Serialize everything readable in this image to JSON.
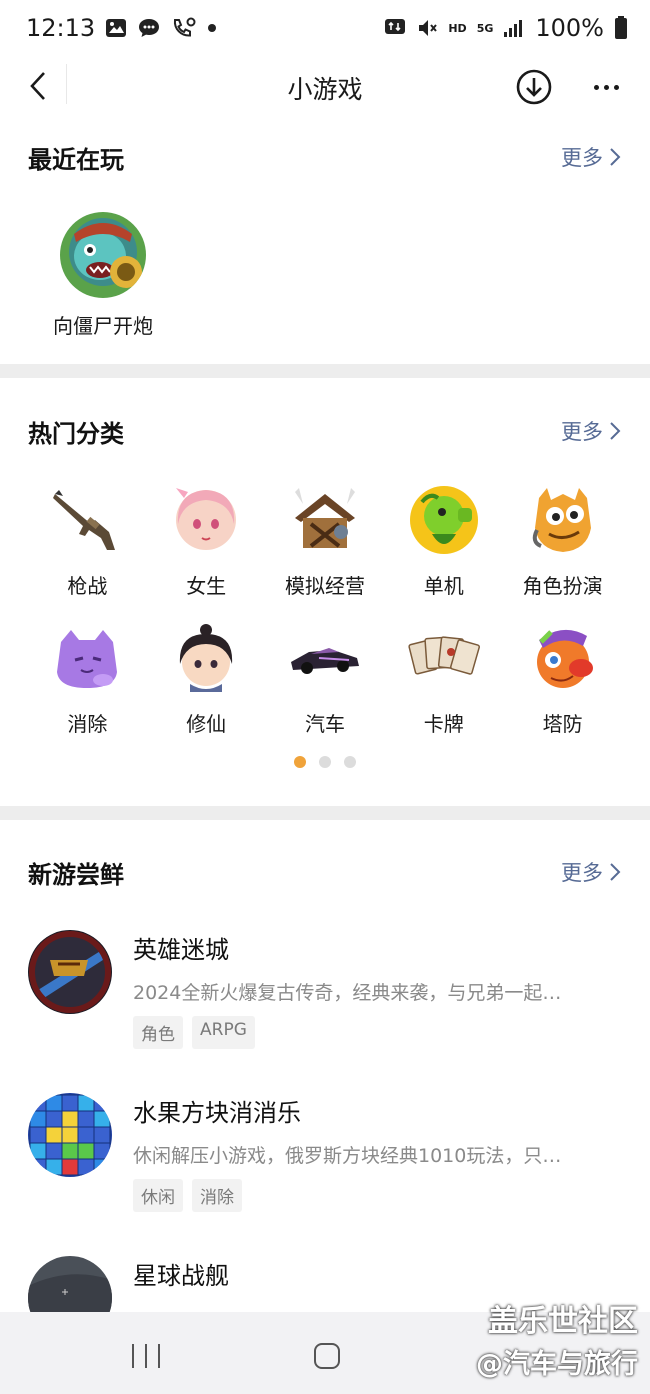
{
  "status_bar": {
    "time": "12:13",
    "battery": "100%",
    "hd": "HD",
    "net": "5G",
    "icons_left": [
      "image-icon",
      "chat-bubble-icon",
      "phone-location-icon",
      "dot-icon"
    ],
    "icons_right": [
      "sync-icon",
      "mute-icon",
      "signal-icon",
      "battery-icon"
    ]
  },
  "nav": {
    "title": "小游戏",
    "back_icon": "chevron-left-icon",
    "download_icon": "download-circle-icon",
    "more_icon": "more-dots-icon"
  },
  "recent": {
    "title": "最近在玩",
    "more": "更多",
    "items": [
      {
        "name": "向僵尸开炮",
        "icon": "zombie-game-icon"
      }
    ]
  },
  "categories": {
    "title": "热门分类",
    "more": "更多",
    "items": [
      {
        "label": "枪战",
        "icon": "rifle-icon"
      },
      {
        "label": "女生",
        "icon": "anime-girl-icon"
      },
      {
        "label": "模拟经营",
        "icon": "cabin-icon"
      },
      {
        "label": "单机",
        "icon": "peashooter-icon"
      },
      {
        "label": "角色扮演",
        "icon": "orange-monster-icon"
      },
      {
        "label": "消除",
        "icon": "purple-cat-icon"
      },
      {
        "label": "修仙",
        "icon": "cultivator-icon"
      },
      {
        "label": "汽车",
        "icon": "race-car-icon"
      },
      {
        "label": "卡牌",
        "icon": "playing-cards-icon"
      },
      {
        "label": "塔防",
        "icon": "tower-defense-bird-icon"
      }
    ],
    "pages": 3,
    "active_page": 1
  },
  "new_games": {
    "title": "新游尝鲜",
    "more": "更多",
    "items": [
      {
        "name": "英雄迷城",
        "desc": "2024全新火爆复古传奇，经典来袭，与兄弟一起…",
        "tags": [
          "角色",
          "ARPG"
        ],
        "icon": "hero-city-game-icon"
      },
      {
        "name": "水果方块消消乐",
        "desc": "休闲解压小游戏，俄罗斯方块经典1010玩法，只…",
        "tags": [
          "休闲",
          "消除"
        ],
        "icon": "block-puzzle-game-icon"
      },
      {
        "name": "星球战舰",
        "desc": "",
        "tags": [],
        "icon": "star-warship-game-icon"
      }
    ]
  },
  "watermark": {
    "line1": "盖乐世社区",
    "line2": "@汽车与旅行"
  },
  "colors": {
    "link": "#576b95",
    "active_dot": "#f0a33a",
    "band": "#ededed"
  }
}
